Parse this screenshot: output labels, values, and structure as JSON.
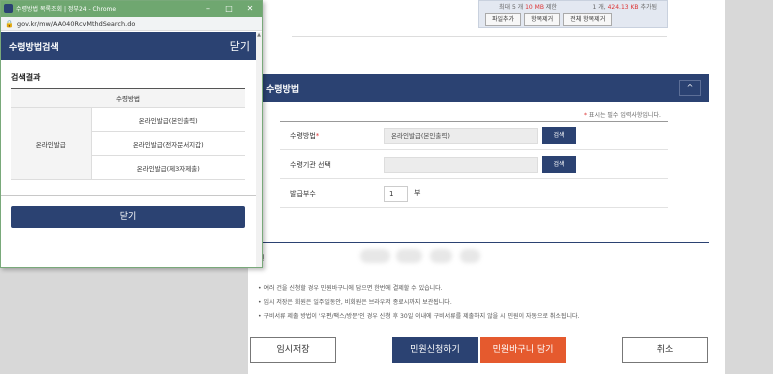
{
  "background": {
    "upload": {
      "limit_prefix": "최대 5 개 ",
      "limit_size": "10 MB",
      "limit_suffix": " 제한",
      "count_prefix": "1 개, ",
      "count_size": "424.13 KB",
      "count_suffix": " 추가됨",
      "buttons": [
        "파일추가",
        "항목제거",
        "전체 항목제거"
      ]
    },
    "section": {
      "title": "수령방법",
      "chevron": "^",
      "required_note": "표시는 필수 입력사항입니다.",
      "rows": {
        "method_label": "수령방법",
        "method_value": "온라인발급(본인출력)",
        "method_btn": "검색",
        "agency_label": "수령기관 선택",
        "agency_value": "",
        "agency_btn": "검색",
        "copies_label": "발급부수",
        "copies_value": "1",
        "copies_unit": "부"
      }
    },
    "min_label": "원",
    "notes": [
      "• 여러 건을 신청할 경우 민원바구니에 담으면 한번에 결제할 수 있습니다.",
      "• 임시 저장은 회원은 일주일동안, 비회원은 브라우저 종료시까지 보관됩니다.",
      "• 구비서류 제출 방법이 '우편/팩스/방문'인 경우 신청 후 30일 이내에 구비서류를 제출하지 않을 시 민원이 자동으로 취소됩니다."
    ],
    "buttons": {
      "temp_save": "임시저장",
      "apply": "민원신청하기",
      "cart": "민원바구니 담기",
      "cancel": "취소"
    }
  },
  "popup": {
    "window_title": "수령방법 목록조회 | 정부24 - Chrome",
    "window_controls": [
      "–",
      "□",
      "✕"
    ],
    "url": "gov.kr/mw/AA040RcvMthdSearch.do",
    "header_title": "수령방법검색",
    "header_close": "닫기",
    "result_title": "검색결과",
    "table": {
      "header": "수령방법",
      "group": "온라인발급",
      "options": [
        "온라인발급(본인출력)",
        "온라인발급(전자문서지갑)",
        "온라인발급(제3자제출)"
      ]
    },
    "close_button": "닫기"
  },
  "colors": {
    "navy": "#2b4272",
    "orange": "#e55a2e",
    "chrome_green": "#6fa770",
    "required_red": "#d33333"
  }
}
